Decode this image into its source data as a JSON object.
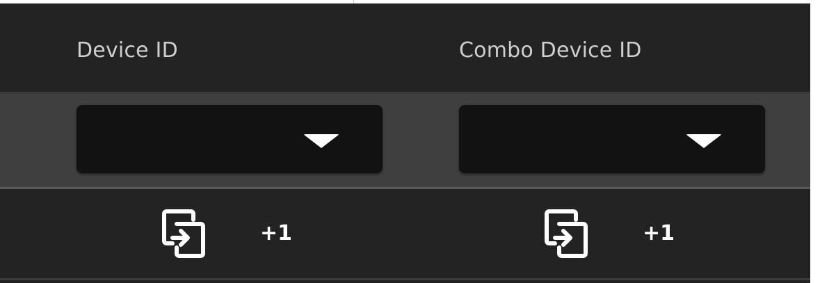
{
  "columns": [
    {
      "label": "Device ID",
      "dropdown_value": "",
      "action_icon": "copy-to-icon",
      "count": "+1"
    },
    {
      "label": "Combo Device ID",
      "dropdown_value": "",
      "action_icon": "copy-to-icon",
      "count": "+1"
    }
  ],
  "colors": {
    "background": "#232323",
    "select_row": "#3f3f3f",
    "dropdown": "#121212",
    "text": "#cfcfcf",
    "icon": "#ffffff"
  }
}
